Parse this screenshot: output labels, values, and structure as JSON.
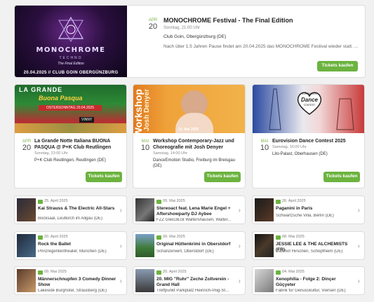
{
  "featured": {
    "image_text": {
      "logo": "MONOCHROME",
      "sub": "TECHNO",
      "tag": "The Final Edition",
      "footer": "20.04.2025 // CLUB GOIN OBERGÜNZBURG"
    },
    "month": "APR",
    "day": "20",
    "title": "MONOCHROME Festival - The Final Edition",
    "time": "Sonntag, 21:00 Uhr",
    "venue": "Club Goin, Obergünzburg (DE)",
    "description": "Nach über 1.5 Jahren Pause findet am 20.04.2025 das MONOCHROME Festival wieder statt. ...",
    "button": "Tickets kaufen"
  },
  "cards": [
    {
      "image_text": [
        "LA GRANDE",
        "Buona Pasqua",
        "OSTERSONNTAG 20.04.2025",
        "VINNY"
      ],
      "month": "Apr",
      "day": "20",
      "title": "La Grande Notte Italiana BUONA PASQUA @ P+K Club Reutlingen",
      "time": "Sonntag, 23:00 Uhr",
      "venue": "P+K Club Reutlingen, Reutlingen (DE)",
      "button": "Tickets kaufen"
    },
    {
      "image_text": [
        "Workshop",
        "Josh Denyer",
        "10. Mai 2025"
      ],
      "month": "Mai",
      "day": "10",
      "title": "Workshop Contemporary-Jazz und Choreografie mit Josh Denyer",
      "time": "Samstag, 14:00 Uhr",
      "venue": "DanceEmotion Studio, Freiburg im Breisgau (DE)",
      "button": "Tickets kaufen"
    },
    {
      "image_text": [
        "EUROVISION",
        "Dance",
        "CONTEST"
      ],
      "month": "Mai",
      "day": "10",
      "title": "Eurovision Dance Contest 2025",
      "time": "Samstag, 16:00 Uhr",
      "venue": "Lito-Palast, Oberhausen (DE)",
      "button": "Tickets kaufen"
    }
  ],
  "list": [
    {
      "date": "25. April 2025",
      "title": "Kai Strauss & The Electric All-Stars",
      "venue": "Bocksaal, Leutkirch im Allgäu (DE)"
    },
    {
      "date": "09. Mai 2025",
      "title": "Stereoact feat. Lena Marie Engel + Aftershowparty DJ Aybee",
      "venue": "FZZ Gleis3Eck Waltershausen, Walter..."
    },
    {
      "date": "26. April 2025",
      "title": "Paganini in Paris",
      "venue": "Schwartzsche Villa, Berlin (DE)"
    },
    {
      "date": "20. April 2025",
      "title": "Rock the Ballet",
      "venue": "Prinzregententheater, München (DE)"
    },
    {
      "date": "09. Mai 2025",
      "title": "Original Hüttenkrimi in Oberstdorf",
      "venue": "Schanzenwirt, Oberstdorf (DE)"
    },
    {
      "date": "08. Mai 2025",
      "title": "JESSIE LEE & THE ALCHEMISTS (FR)",
      "venue": "Gasthof Hirschen, Schopfheim (DE)"
    },
    {
      "date": "09. Mai 2025",
      "title": "Männerschnupfen 3 Comedy Dinner Show",
      "venue": "Lakeside Burghotel, Strausberg (DE)"
    },
    {
      "date": "20. April 2025",
      "title": "20. MIG \"Ruhr\" Zeche Zollverein - Grand Hall",
      "venue": "Treffpunkt Parkplatz Heinrich-Imig-St..."
    },
    {
      "date": "04. Mai 2025",
      "title": "Xenophilia - Folge 2: Dinçer Güçyeter",
      "venue": "Fabrik für Genusskultur, Viersen (DE)"
    }
  ]
}
